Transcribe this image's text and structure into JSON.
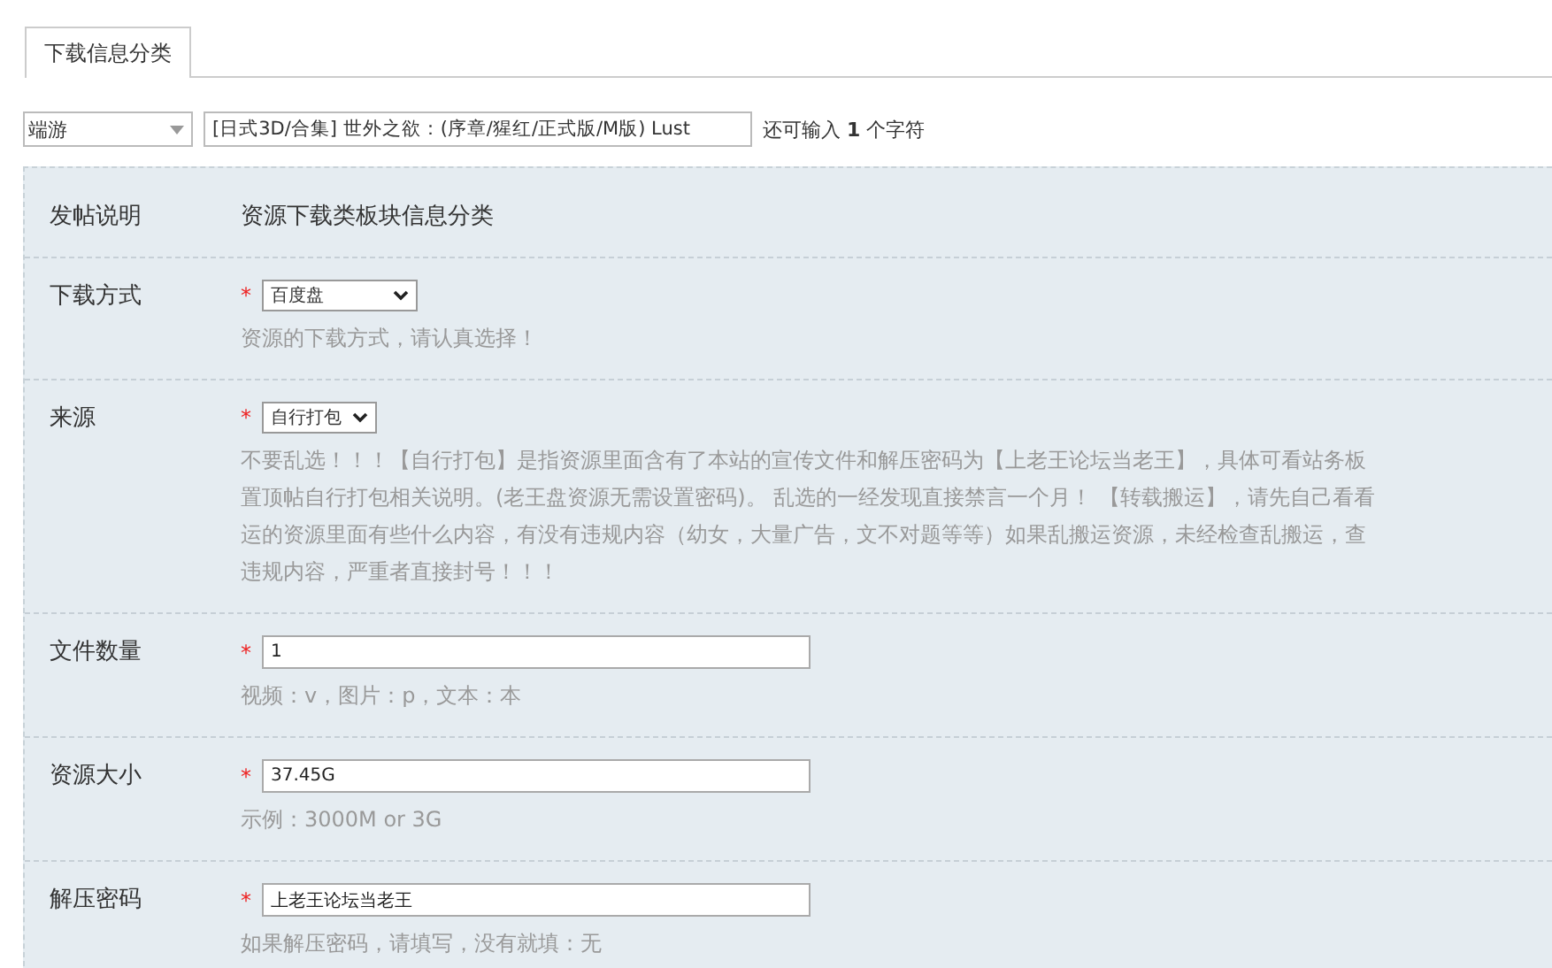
{
  "tabs": [
    {
      "label": "下载信息分类",
      "selected": true
    }
  ],
  "title_row": {
    "category": "端游",
    "title": "[日式3D/合集] 世外之欲：(序章/猩红/正式版/M版) Lust",
    "remaining_prefix": "还可输入",
    "remaining_count": "1",
    "remaining_suffix": "个字符"
  },
  "form": {
    "intro": {
      "label": "发帖说明",
      "text": "资源下载类板块信息分类"
    },
    "fields": [
      {
        "kind": "select",
        "label": "下载方式",
        "required_mark": "*",
        "value": "百度盘",
        "wide": true,
        "hint_lines": [
          "资源的下载方式，请认真选择！"
        ]
      },
      {
        "kind": "select",
        "label": "来源",
        "required_mark": "*",
        "value": "自行打包",
        "wide": false,
        "hint_lines": [
          "不要乱选！！！【自行打包】是指资源里面含有了本站的宣传文件和解压密码为【上老王论坛当老王】，具体可看站务板",
          "置顶帖自行打包相关说明。(老王盘资源无需设置密码)。 乱选的一经发现直接禁言一个月！ 【转载搬运】，请先自己看看",
          "运的资源里面有些什么内容，有没有违规内容（幼女，大量广告，文不对题等等）如果乱搬运资源，未经检查乱搬运，查",
          "违规内容，严重者直接封号！！！"
        ]
      },
      {
        "kind": "text",
        "label": "文件数量",
        "required_mark": "*",
        "value": "1",
        "hint_lines": [
          "视频：v，图片：p，文本：本"
        ]
      },
      {
        "kind": "text",
        "label": "资源大小",
        "required_mark": "*",
        "value": "37.45G",
        "hint_lines": [
          "示例：3000M or 3G"
        ]
      },
      {
        "kind": "text",
        "label": "解压密码",
        "required_mark": "*",
        "value": "上老王论坛当老王",
        "hint_lines": [
          "如果解压密码，请填写，没有就填：无"
        ]
      }
    ]
  }
}
